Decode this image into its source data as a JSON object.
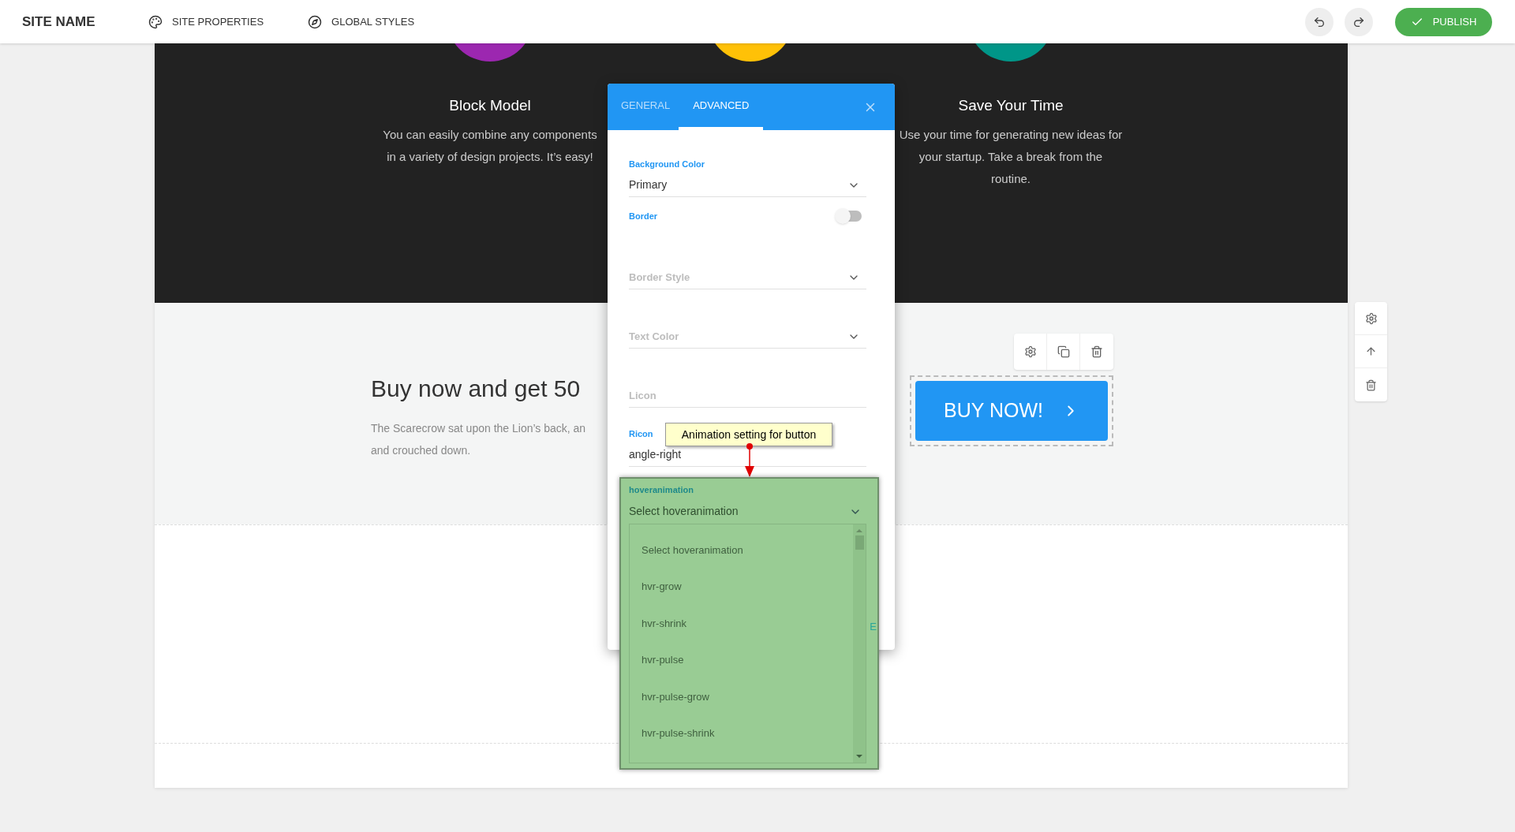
{
  "top_bar": {
    "site_name": "SITE NAME",
    "nav": [
      {
        "kind": "palette",
        "label": "SITE PROPERTIES"
      },
      {
        "kind": "compass",
        "label": "GLOBAL STYLES"
      }
    ],
    "publish": "PUBLISH"
  },
  "features": [
    {
      "color": "#9c27b0",
      "title": "Block Model",
      "lines": [
        "You can easily combine any components",
        "in a variety of design projects. It’s easy!"
      ]
    },
    {
      "color": "#ffc107"
    },
    {
      "color": "#009688",
      "title": "Save Your Time",
      "lines": [
        "Use your time for generating new ideas for",
        "your startup. Take a break from the",
        "routine."
      ]
    }
  ],
  "promo": {
    "heading": "Buy now and get 50",
    "lines": [
      "The Scarecrow sat upon the Lion’s back, an",
      "and crouched down."
    ],
    "button": "BUY NOW!"
  },
  "modal": {
    "tabs": [
      {
        "label": "GENERAL",
        "selected": false
      },
      {
        "label": "ADVANCED",
        "selected": true
      }
    ],
    "fields": [
      {
        "kind": "select",
        "label": "Background Color",
        "value": "Primary"
      },
      {
        "kind": "toggle",
        "label": "Border",
        "on": false
      },
      {
        "kind": "select",
        "label": "Border Style"
      },
      {
        "kind": "select",
        "label": "Text Color"
      },
      {
        "kind": "text",
        "label": "Licon"
      },
      {
        "kind": "text",
        "label": "Ricon",
        "value": "angle-right"
      }
    ],
    "footer_text": "E",
    "hover_field": {
      "label": "hoveranimation",
      "value": "Select hoveranimation",
      "options": [
        "Select hoveranimation",
        "hvr-grow",
        "hvr-shrink",
        "hvr-pulse",
        "hvr-pulse-grow",
        "hvr-pulse-shrink"
      ]
    },
    "tooltip": "Animation setting for button"
  }
}
